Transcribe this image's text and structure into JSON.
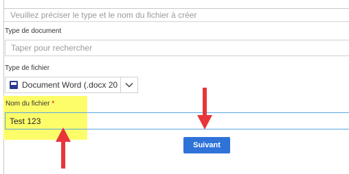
{
  "intro": {
    "text": "Veuillez préciser le type et le nom du fichier à créer"
  },
  "document_type": {
    "label": "Type de document",
    "placeholder": "Taper pour rechercher"
  },
  "file_type": {
    "label": "Type de fichier",
    "selected": "Document Word (.docx 20",
    "icon": "word-document-icon"
  },
  "file_name": {
    "label": "Nom du fichier",
    "required_marker": "*",
    "value": "Test 123"
  },
  "submit": {
    "label": "Suivant"
  },
  "annotations": {
    "highlight_color": "#fdfd6a",
    "arrow_color": "#e8353a"
  },
  "colors": {
    "accent": "#2f73d9",
    "focus_border": "#5aa4e6",
    "required": "#e00000"
  }
}
